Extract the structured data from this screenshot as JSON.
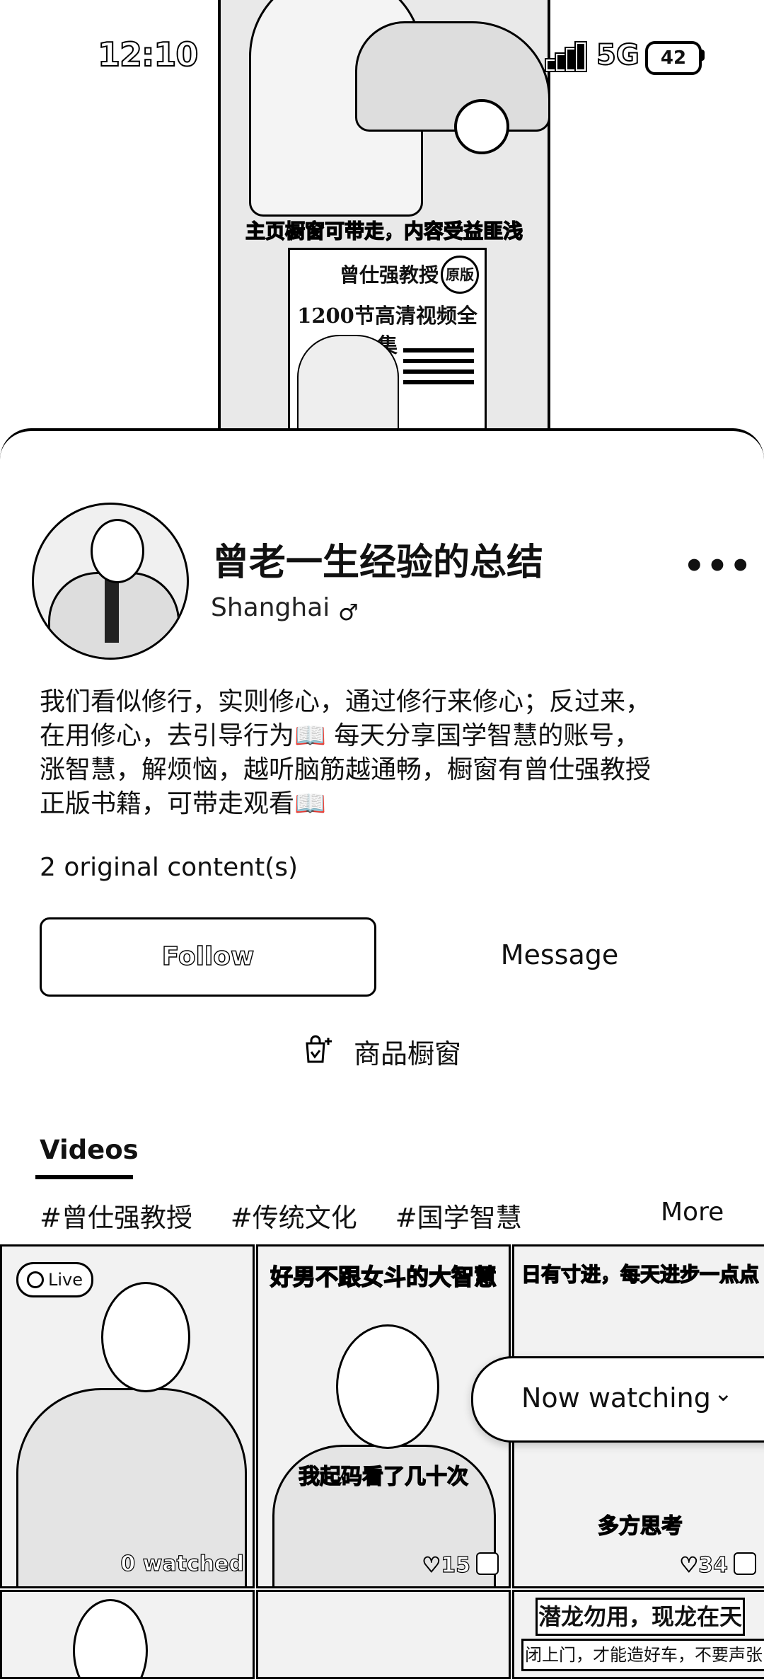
{
  "status_bar": {
    "time": "12:10",
    "network": "5G",
    "battery": "42"
  },
  "video": {
    "subtitle": "主页橱窗可带走，内容受益匪浅",
    "book_title": "曾仕强教授",
    "book_badge": "原版",
    "book_subtitle": "1200节高清视频全集"
  },
  "profile": {
    "name": "曾老一生经验的总结",
    "location": "Shanghai",
    "gender_symbol": "♂",
    "more_icon": "more-horizontal-icon",
    "bio_lines": [
      "我们看似修行，实则修心，通过修行来修心；反过来，",
      "在用修心，去引导行为📖 每天分享国学智慧的账号，",
      "涨智慧，解烦恼，越听脑筋越通畅，橱窗有曾仕强教授",
      "正版书籍，可带走观看📖"
    ],
    "original_content": "2 original content(s)"
  },
  "actions": {
    "follow_label": "Follow",
    "message_label": "Message",
    "shop_label": "商品橱窗"
  },
  "tabs": {
    "videos_label": "Videos",
    "tags": [
      "#曾仕强教授",
      "#传统文化",
      "#国学智慧"
    ],
    "more_label": "More"
  },
  "grid": {
    "items": [
      {
        "badge": "Live",
        "watched": "0 watched"
      },
      {
        "top_caption": "好男不跟女斗的大智慧",
        "mid_caption": "我起码看了几十次",
        "likes": "♡15"
      },
      {
        "top_caption": "日有寸进，每天进步一点点",
        "mid_caption": "多方思考",
        "likes": "♡34"
      },
      {},
      {},
      {
        "box_caption": "潜龙勿用，现龙在天",
        "box_caption2": "闭上门，才能造好车，不要声张"
      }
    ]
  },
  "now_watching": {
    "label": "Now watching",
    "chevron": "⌄"
  }
}
